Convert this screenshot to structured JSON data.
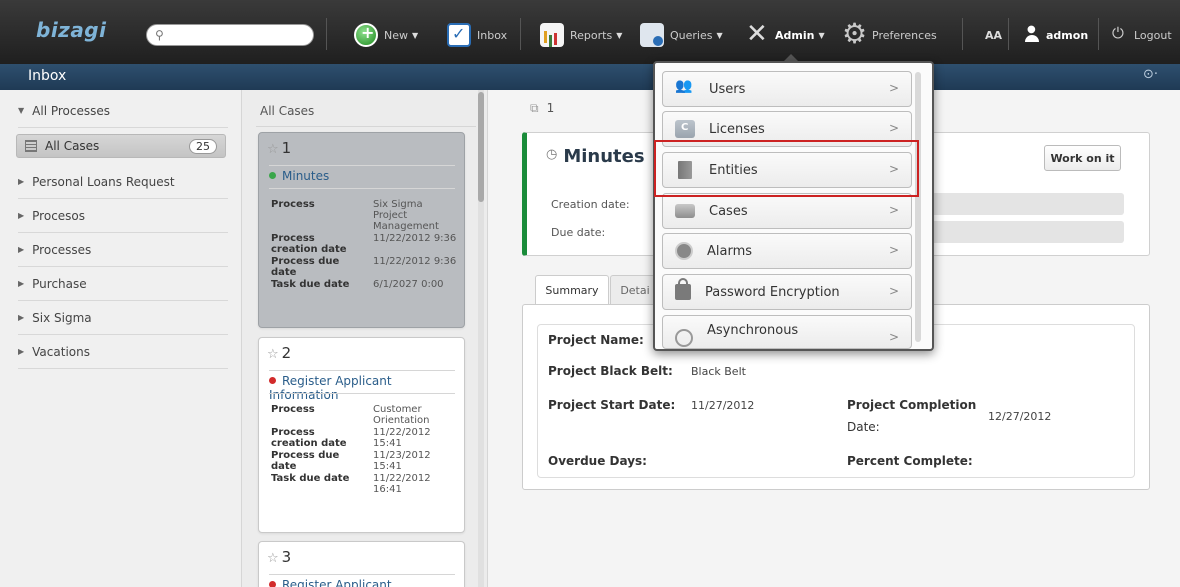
{
  "app": {
    "logo": "bizagi"
  },
  "search": {
    "placeholder": ""
  },
  "nav": {
    "new": "New",
    "inbox": "Inbox",
    "reports": "Reports",
    "queries": "Queries",
    "admin": "Admin",
    "preferences": "Preferences",
    "font_size": "AA",
    "user": "admon",
    "logout": "Logout"
  },
  "inbox_bar": {
    "title": "Inbox"
  },
  "left_panel": {
    "all_processes": "All Processes",
    "all_cases": {
      "label": "All Cases",
      "count": "25"
    },
    "items": [
      "Personal Loans Request",
      "Procesos",
      "Processes",
      "Purchase",
      "Six Sigma",
      "Vacations"
    ]
  },
  "case_list": {
    "header": "All Cases",
    "cards": [
      {
        "number": "1",
        "task": "Minutes",
        "task_status_color": "#3aa64a",
        "rows": [
          {
            "k": "Process",
            "v": "Six Sigma Project Management"
          },
          {
            "k": "Process creation date",
            "v": "11/22/2012 9:36"
          },
          {
            "k": "Process due date",
            "v": "11/22/2012 9:36"
          },
          {
            "k": "Task due date",
            "v": "6/1/2027 0:00"
          }
        ]
      },
      {
        "number": "2",
        "task": "Register Applicant Information",
        "task_status_color": "#d22b2b",
        "rows": [
          {
            "k": "Process",
            "v": "Customer Orientation"
          },
          {
            "k": "Process creation date",
            "v": "11/22/2012 15:41"
          },
          {
            "k": "Process due date",
            "v": "11/23/2012 15:41"
          },
          {
            "k": "Task due date",
            "v": "11/22/2012 16:41"
          }
        ]
      },
      {
        "number": "3",
        "task": "Register Applicant Information",
        "task_status_color": "#d22b2b"
      }
    ]
  },
  "detail": {
    "case_number": "1",
    "task_title": "Minutes",
    "work_on_it": "Work on it",
    "creation_date_label": "Creation date:",
    "due_date_label": "Due date:",
    "tabs": [
      "Summary",
      "Detai"
    ],
    "summary": {
      "project_name_label": "Project Name:",
      "project_black_belt_label": "Project Black Belt:",
      "project_black_belt_value": "Black Belt",
      "project_start_date_label": "Project Start Date:",
      "project_start_date_value": "11/27/2012",
      "project_completion_date_label_1": "Project Completion",
      "project_completion_date_label_2": "Date:",
      "project_completion_date_value": "12/27/2012",
      "overdue_days_label": "Overdue Days:",
      "percent_complete_label": "Percent Complete:"
    }
  },
  "admin_menu": {
    "items": [
      "Users",
      "Licenses",
      "Entities",
      "Cases",
      "Alarms",
      "Password Encryption",
      "Asynchronous"
    ],
    "highlighted": "Entities",
    "highlight_color": "#cc2222"
  }
}
